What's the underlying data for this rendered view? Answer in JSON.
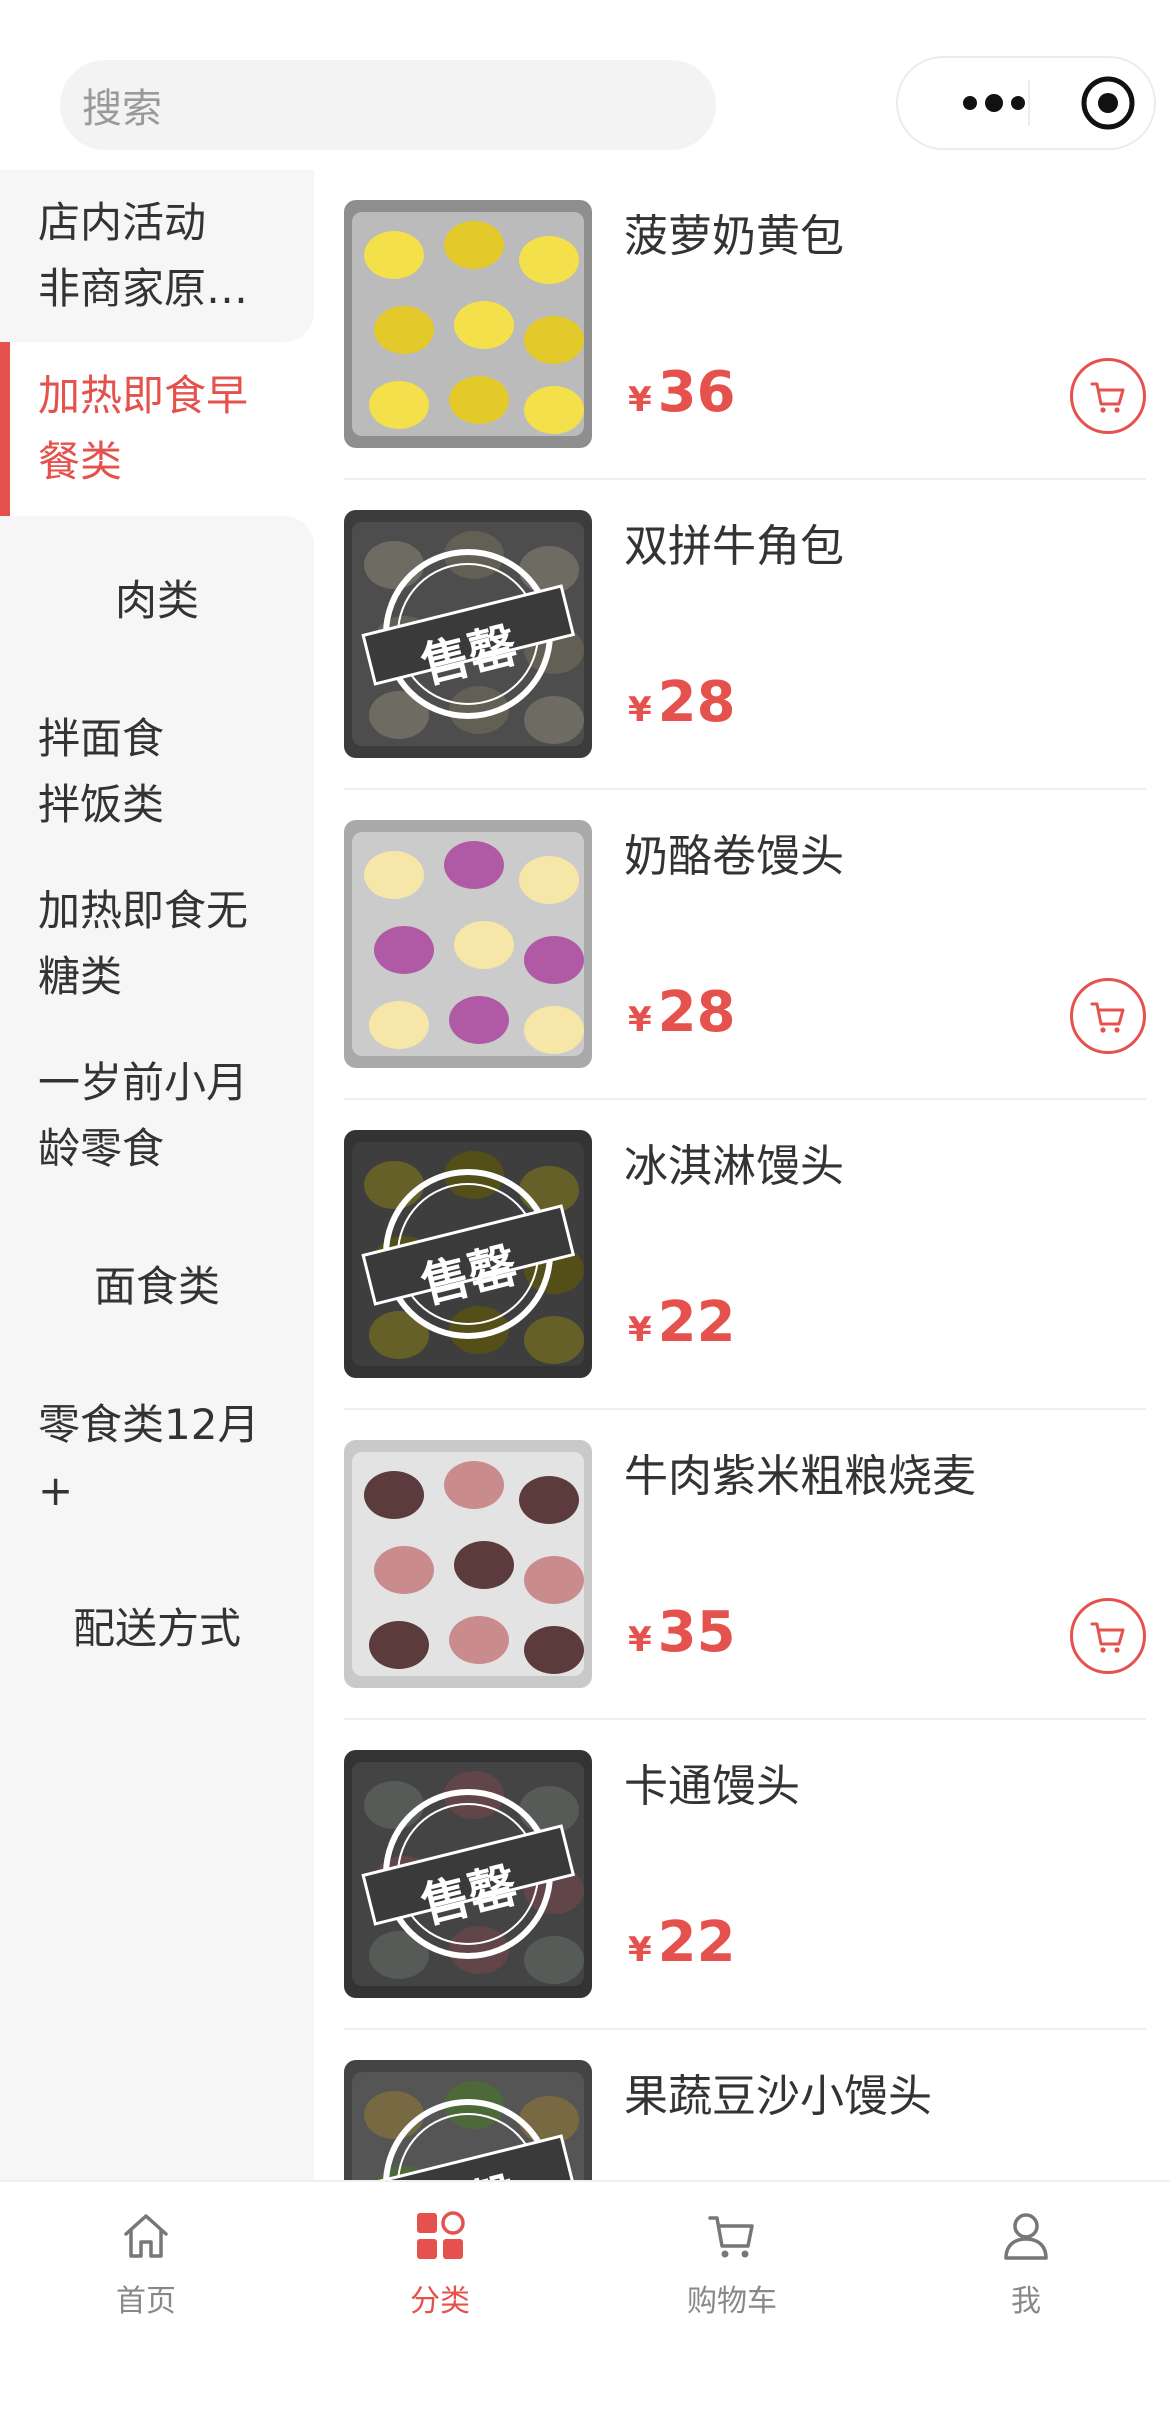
{
  "search": {
    "placeholder": "搜索"
  },
  "capsule": {
    "more_icon": "more-dots-icon",
    "close_icon": "target-circle-icon"
  },
  "sidebar": {
    "items": [
      {
        "label_lines": [
          "店内活动",
          "非商家原…"
        ]
      },
      {
        "label_lines": [
          "加热即食早",
          "餐类"
        ],
        "active": true
      },
      {
        "label_lines": [
          "肉类"
        ]
      },
      {
        "label_lines": [
          "拌面食",
          "拌饭类"
        ]
      },
      {
        "label_lines": [
          "加热即食无",
          "糖类"
        ]
      },
      {
        "label_lines": [
          "一岁前小月",
          "龄零食"
        ]
      },
      {
        "label_lines": [
          "面食类"
        ]
      },
      {
        "label_lines": [
          "零食类12月",
          "+"
        ]
      },
      {
        "label_lines": [
          "配送方式"
        ]
      }
    ]
  },
  "products": [
    {
      "name": "菠萝奶黄包",
      "currency": "¥",
      "price": "36",
      "sold_out": false,
      "has_cart": true
    },
    {
      "name": "双拼牛角包",
      "currency": "¥",
      "price": "28",
      "sold_out": true,
      "has_cart": false
    },
    {
      "name": "奶酪卷馒头",
      "currency": "¥",
      "price": "28",
      "sold_out": false,
      "has_cart": true
    },
    {
      "name": "冰淇淋馒头",
      "currency": "¥",
      "price": "22",
      "sold_out": true,
      "has_cart": false
    },
    {
      "name": "牛肉紫米粗粮烧麦",
      "currency": "¥",
      "price": "35",
      "sold_out": false,
      "has_cart": true
    },
    {
      "name": "卡通馒头",
      "currency": "¥",
      "price": "22",
      "sold_out": true,
      "has_cart": false
    },
    {
      "name": "果蔬豆沙小馒头",
      "currency": "¥",
      "price": "",
      "sold_out": true,
      "has_cart": false
    }
  ],
  "soldout_stamp": "售罄",
  "tabbar": {
    "items": [
      {
        "label": "首页",
        "icon": "home-icon",
        "active": false
      },
      {
        "label": "分类",
        "icon": "category-icon",
        "active": true
      },
      {
        "label": "购物车",
        "icon": "cart-icon",
        "active": false
      },
      {
        "label": "我",
        "icon": "user-icon",
        "active": false
      }
    ]
  },
  "colors": {
    "accent": "#e5524d",
    "sidebar_bg": "#f6f6f6",
    "text": "#333333",
    "muted": "#888888"
  }
}
